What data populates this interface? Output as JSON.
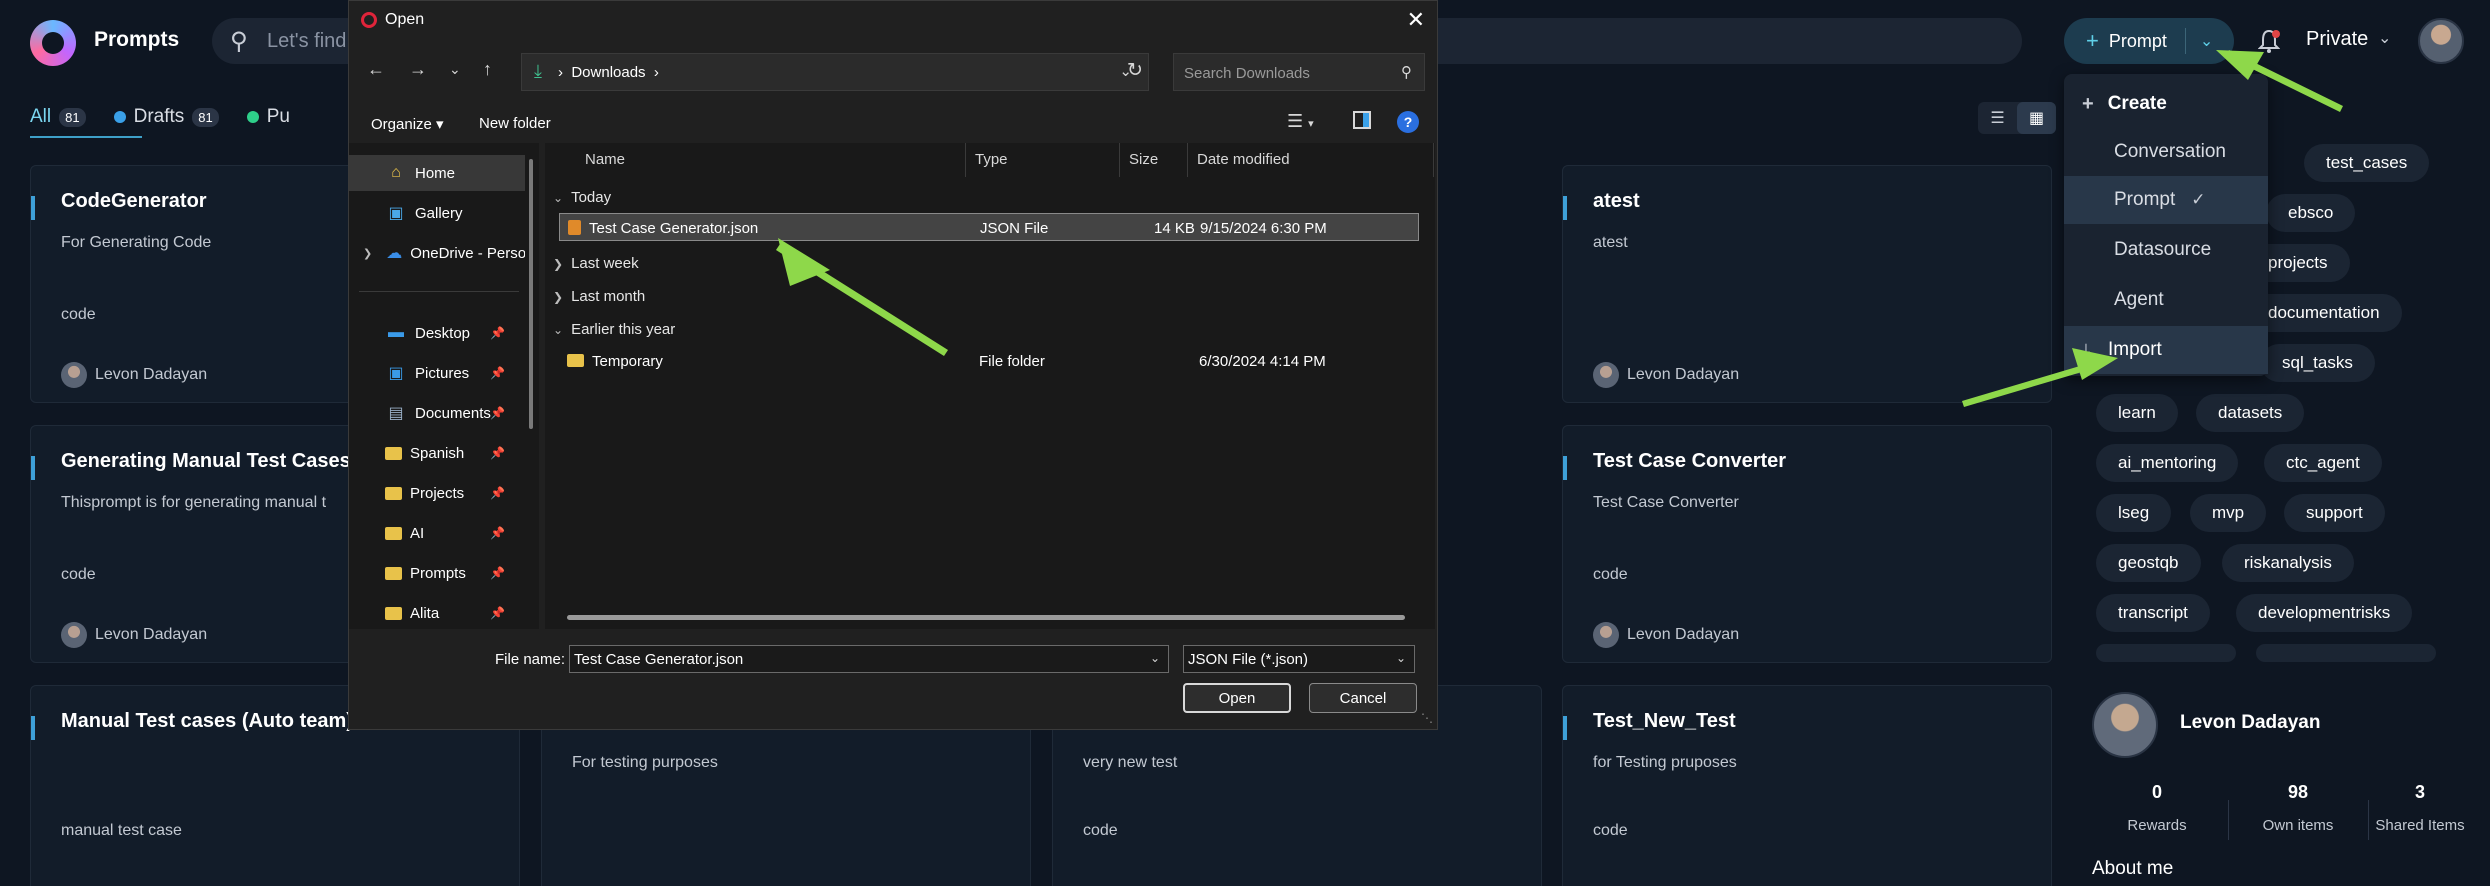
{
  "app": {
    "title": "Prompts",
    "search_placeholder": "Let's find"
  },
  "header": {
    "prompt_button_label": "Prompt",
    "private_label": "Private"
  },
  "tabs": [
    {
      "label": "All",
      "count": "81"
    },
    {
      "label": "Drafts",
      "count": "81"
    },
    {
      "label": "Pu"
    }
  ],
  "cards": [
    {
      "title": "CodeGenerator",
      "description": "For Generating Code",
      "tag": "code",
      "author": "Levon Dadayan"
    },
    {
      "title": "atest",
      "description": "atest",
      "tag": "",
      "author": "Levon Dadayan"
    },
    {
      "title": "Generating Manual Test Cases",
      "description": "Thisprompt is for generating manual t",
      "tag": "code",
      "author": "Levon Dadayan"
    },
    {
      "title": "Test Case Converter",
      "description": "Test Case Converter",
      "tag": "code",
      "author": "Levon Dadayan"
    },
    {
      "title": "Manual Test cases (Auto team)",
      "description": "",
      "tag": "manual test case",
      "author": ""
    },
    {
      "title": "",
      "description": "For testing purposes",
      "tag": "",
      "author": ""
    },
    {
      "title": "",
      "description": "very new test",
      "tag": "code",
      "author": ""
    },
    {
      "title": "Test_New_Test",
      "description": "for Testing pruposes",
      "tag": "code",
      "author": ""
    }
  ],
  "tags": [
    "test_cases",
    "ebsco",
    "projects",
    "documentation",
    "sql_tasks",
    "learn",
    "datasets",
    "ai_mentoring",
    "ctc_agent",
    "lseg",
    "mvp",
    "support",
    "geostqb",
    "riskanalysis",
    "transcript",
    "developmentrisks"
  ],
  "profile": {
    "name": "Levon Dadayan",
    "stats": [
      {
        "value": "0",
        "label": "Rewards"
      },
      {
        "value": "98",
        "label": "Own items"
      },
      {
        "value": "3",
        "label": "Shared Items"
      }
    ],
    "about_label": "About me"
  },
  "menu": {
    "create": "Create",
    "items": [
      "Conversation",
      "Prompt",
      "Datasource",
      "Agent"
    ],
    "selected": "Prompt",
    "import": "Import"
  },
  "dialog": {
    "title": "Open",
    "path": "Downloads",
    "search_placeholder": "Search Downloads",
    "organize": "Organize",
    "new_folder": "New folder",
    "sidebar": {
      "top": [
        "Home",
        "Gallery",
        "OneDrive - Perso"
      ],
      "pinned": [
        "Desktop",
        "Pictures",
        "Documents",
        "Spanish",
        "Projects",
        "AI",
        "Prompts",
        "Alita"
      ]
    },
    "columns": [
      "Name",
      "Type",
      "Size",
      "Date modified"
    ],
    "groups": {
      "today": "Today",
      "last_week": "Last week",
      "last_month": "Last month",
      "earlier": "Earlier this year"
    },
    "files": [
      {
        "name": "Test Case Generator.json",
        "type": "JSON File",
        "size": "14 KB",
        "date": "9/15/2024 6:30 PM"
      },
      {
        "name": "Temporary",
        "type": "File folder",
        "size": "",
        "date": "6/30/2024 4:14 PM"
      }
    ],
    "file_name_label": "File name:",
    "file_name_value": "Test Case Generator.json",
    "file_type": "JSON File (*.json)",
    "open_label": "Open",
    "cancel_label": "Cancel"
  },
  "colors": {
    "accent": "#3ea0d8",
    "arrow": "#8ed84a",
    "background": "#0e1622"
  }
}
